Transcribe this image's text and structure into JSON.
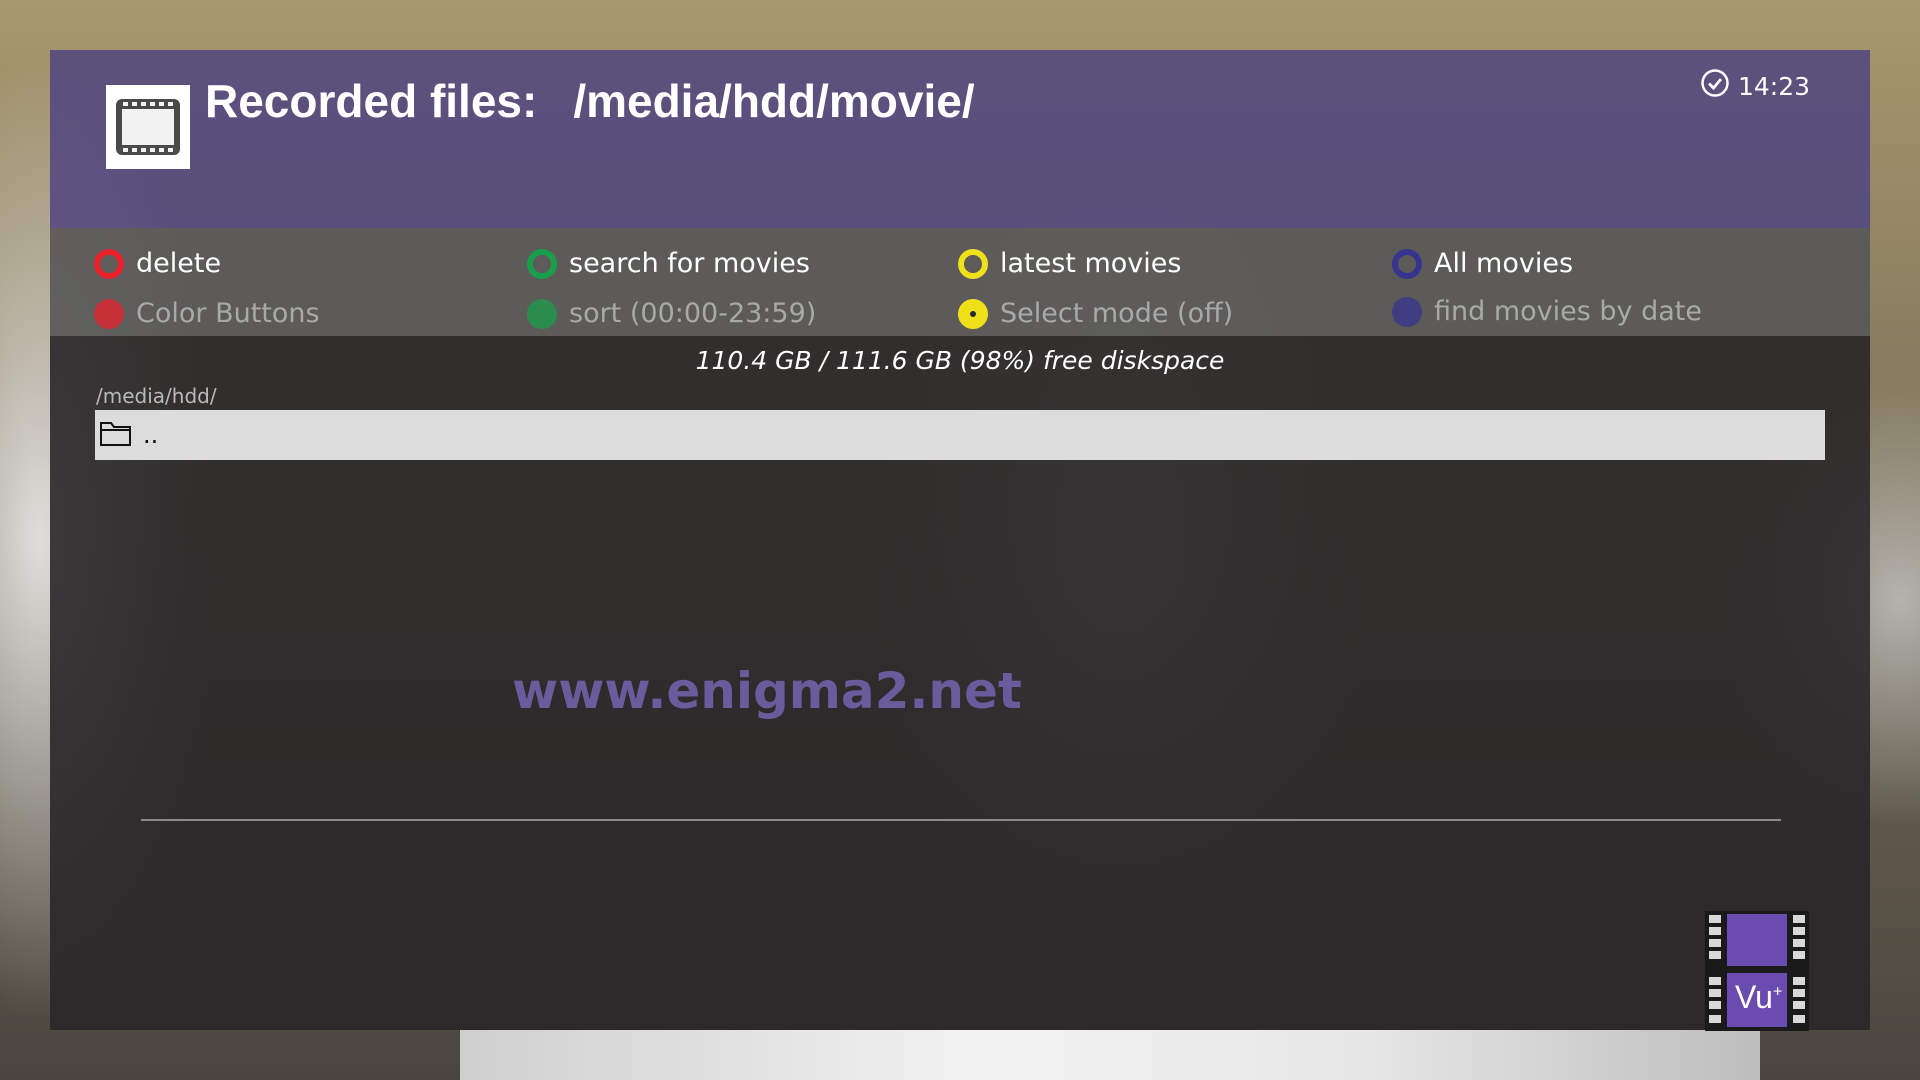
{
  "header": {
    "title_label": "Recorded files:",
    "title_path": "/media/hdd/movie/",
    "clock": "14:23"
  },
  "color_buttons": {
    "primary": [
      {
        "color": "red",
        "hex": "#e8202a",
        "label": "delete"
      },
      {
        "color": "green",
        "hex": "#1a9e4a",
        "label": "search for movies"
      },
      {
        "color": "yellow",
        "hex": "#f0e019",
        "label": "latest movies"
      },
      {
        "color": "blue",
        "hex": "#36348f",
        "label": "All movies"
      }
    ],
    "secondary": [
      {
        "color": "red",
        "hex": "#e8202a",
        "label": "Color Buttons"
      },
      {
        "color": "green",
        "hex": "#1a9e4a",
        "label": "sort (00:00-23:59)"
      },
      {
        "color": "yellow",
        "hex": "#f0e019",
        "label": "Select mode (off)"
      },
      {
        "color": "blue",
        "hex": "#36348f",
        "label": "find movies by date"
      }
    ]
  },
  "diskspace": "110.4 GB / 111.6 GB (98%) free diskspace",
  "current_path": "/media/hdd/",
  "file_list": [
    {
      "icon": "folder-icon",
      "name": ".."
    }
  ],
  "watermark": "www.enigma2.net",
  "logo_text": "Vu",
  "logo_sup": "+"
}
